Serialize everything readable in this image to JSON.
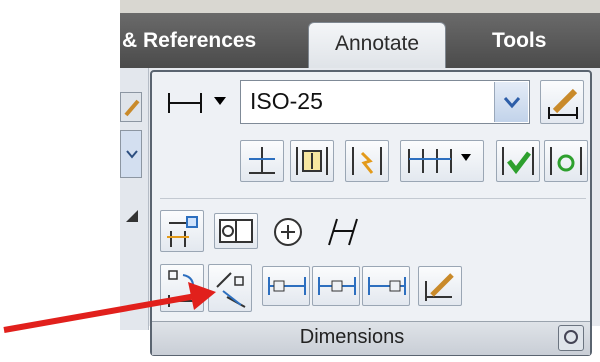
{
  "ribbon": {
    "tabs": [
      {
        "label": "& References"
      },
      {
        "label": "Annotate",
        "active": true
      },
      {
        "label": "Tools"
      }
    ]
  },
  "dimensions_panel": {
    "title": "Dimensions",
    "dimension_style": {
      "value": "ISO-25"
    }
  },
  "colors": {
    "accent": "#2d6fbf",
    "check": "#2ea02e",
    "arrow": "#e1201c",
    "pencil": "#c98a2a"
  }
}
